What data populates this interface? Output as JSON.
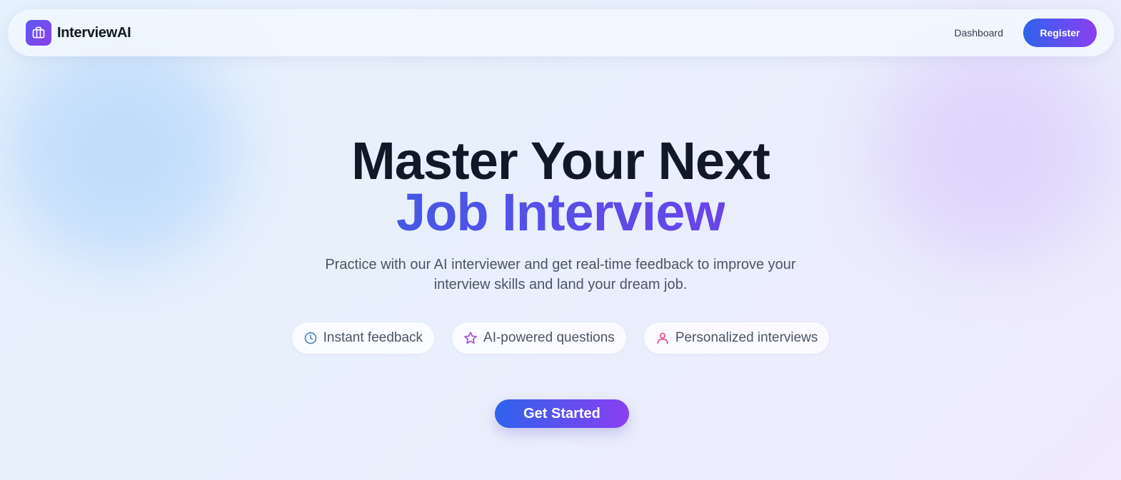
{
  "nav": {
    "brand": "InterviewAI",
    "logo_icon": "briefcase-icon",
    "links": [
      {
        "label": "Dashboard"
      }
    ],
    "register_label": "Register"
  },
  "hero": {
    "headline_line1": "Master Your Next",
    "headline_line2": "Job Interview",
    "subtitle": "Practice with our AI interviewer and get real-time feedback to improve your interview skills and land your dream job.",
    "features": [
      {
        "label": "Instant feedback",
        "icon": "clock-icon",
        "color": "#4a86c8"
      },
      {
        "label": "AI-powered questions",
        "icon": "star-icon",
        "color": "#a24ed6"
      },
      {
        "label": "Personalized interviews",
        "icon": "user-icon",
        "color": "#d94f86"
      }
    ],
    "cta_label": "Get Started"
  },
  "colors": {
    "accent_start": "#2f62ec",
    "accent_end": "#8a3ff1",
    "headline": "#111827",
    "headline_gradient_start": "#4658e6",
    "headline_gradient_end": "#6a44ea"
  }
}
